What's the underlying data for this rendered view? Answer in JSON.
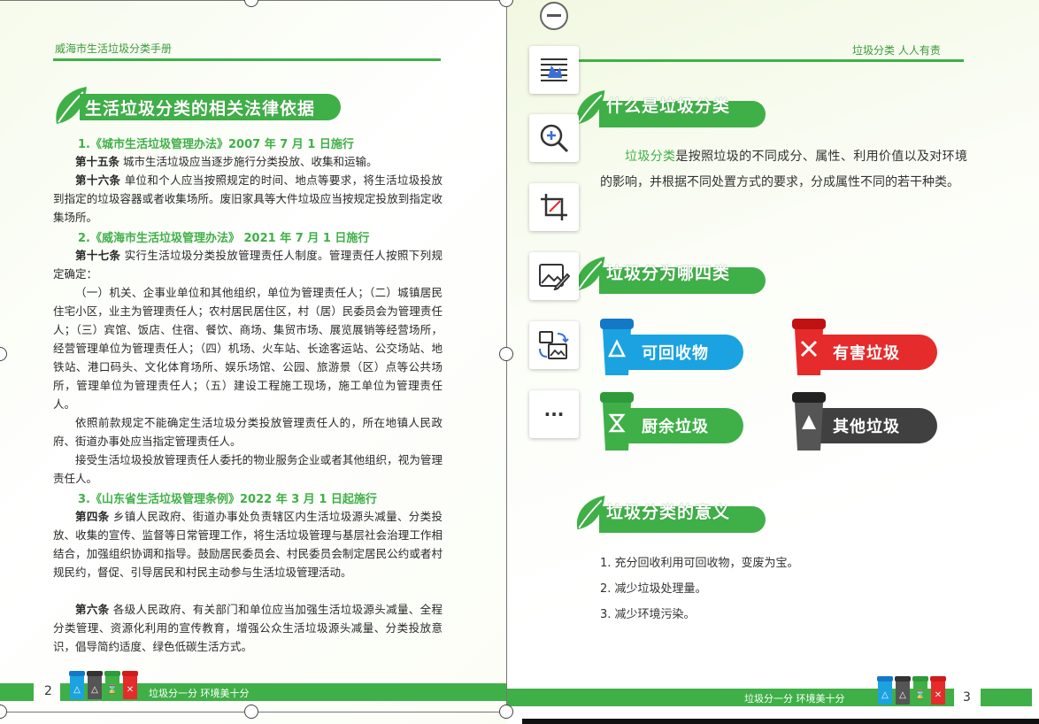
{
  "left_page": {
    "header": "威海市生活垃圾分类手册",
    "banner_title": "生活垃圾分类的相关法律依据",
    "laws": [
      {
        "title": "1.《城市生活垃圾管理办法》2007 年 7 月 1 日施行",
        "paragraphs": [
          {
            "art": "第十五条",
            "text": " 城市生活垃圾应当逐步施行分类投放、收集和运输。"
          },
          {
            "art": "第十六条",
            "text": " 单位和个人应当按照规定的时间、地点等要求，将生活垃圾投放到指定的垃圾容器或者收集场所。废旧家具等大件垃圾应当按规定投放到指定收集场所。"
          }
        ]
      },
      {
        "title": "2.《威海市生活垃圾管理办法》 2021 年 7 月 1 日施行",
        "paragraphs": [
          {
            "art": "第十七条",
            "text": " 实行生活垃圾分类投放管理责任人制度。管理责任人按照下列规定确定："
          },
          {
            "art": "",
            "text": "（一）机关、企事业单位和其他组织，单位为管理责任人；（二）城镇居民住宅小区，业主为管理责任人；农村居民居住区，村（居）民委员会为管理责任人；（三）宾馆、饭店、住宿、餐饮、商场、集贸市场、展览展销等经营场所，经营管理单位为管理责任人；（四）机场、火车站、长途客运站、公交场站、地铁站、港口码头、文化体育场所、娱乐场馆、公园、旅游景（区）点等公共场所，管理单位为管理责任人；（五）建设工程施工现场，施工单位为管理责任人。"
          },
          {
            "art": "",
            "text": "依照前款规定不能确定生活垃圾分类投放管理责任人的，所在地镇人民政府、街道办事处应当指定管理责任人。"
          },
          {
            "art": "",
            "text": "接受生活垃圾投放管理责任人委托的物业服务企业或者其他组织，视为管理责任人。"
          }
        ]
      },
      {
        "title": "3.《山东省生活垃圾管理条例》2022 年 3 月 1 日起施行",
        "paragraphs": [
          {
            "art": "第四条",
            "text": " 乡镇人民政府、街道办事处负责辖区内生活垃圾源头减量、分类投放、收集的宣传、监督等日常管理工作，将生活垃圾管理与基层社会治理工作相结合，加强组织协调和指导。鼓励居民委员会、村民委员会制定居民公约或者村规民约，督促、引导居民和村民主动参与生活垃圾管理活动。"
          },
          {
            "art": "第六条",
            "text": " 各级人民政府、有关部门和单位应当加强生活垃圾源头减量、全程分类管理、资源化利用的宣传教育，增强公众生活垃圾源头减量、分类投放意识，倡导简约适度、绿色低碳生活方式。"
          }
        ]
      }
    ],
    "page_number": "2",
    "footer_slogan": "垃圾分一分 环境美十分"
  },
  "right_page": {
    "header": "垃圾分类 人人有责",
    "section1_title": "什么是垃圾分类",
    "definition_highlight": "垃圾分类",
    "definition_rest": "是按照垃圾的不同成分、属性、利用价值以及对环境的影响，并根据不同处置方式的要求，分成属性不同的若干种类。",
    "section2_title": "垃圾分为哪四类",
    "categories": [
      {
        "label": "可回收物",
        "color": "#1aa3e0",
        "bin_color": "#1478c8"
      },
      {
        "label": "有害垃圾",
        "color": "#e52b2b",
        "bin_color": "#d11a1a"
      },
      {
        "label": "厨余垃圾",
        "color": "#3fb047",
        "bin_color": "#2e9a3a"
      },
      {
        "label": "其他垃圾",
        "color": "#404040",
        "bin_color": "#333333"
      }
    ],
    "section3_title": "垃圾分类的意义",
    "significance": [
      "1.  充分回收利用可回收物，变废为宝。",
      "2.  减少垃圾处理量。",
      "3.  减少环境污染。"
    ],
    "page_number": "3",
    "footer_slogan": "垃圾分一分 环境美十分"
  },
  "toolbar": {
    "buttons": [
      {
        "name": "ocr-text-button",
        "icon": "text-scan-icon"
      },
      {
        "name": "zoom-in-button",
        "icon": "zoom-in-icon"
      },
      {
        "name": "crop-button",
        "icon": "crop-icon"
      },
      {
        "name": "edit-image-button",
        "icon": "image-edit-icon"
      },
      {
        "name": "replace-image-button",
        "icon": "image-swap-icon"
      },
      {
        "name": "more-button",
        "icon": "more-icon",
        "label": "···"
      }
    ]
  },
  "colors": {
    "green": "#3fb047",
    "blue": "#1aa3e0",
    "red": "#e52b2b",
    "dark": "#404040"
  }
}
